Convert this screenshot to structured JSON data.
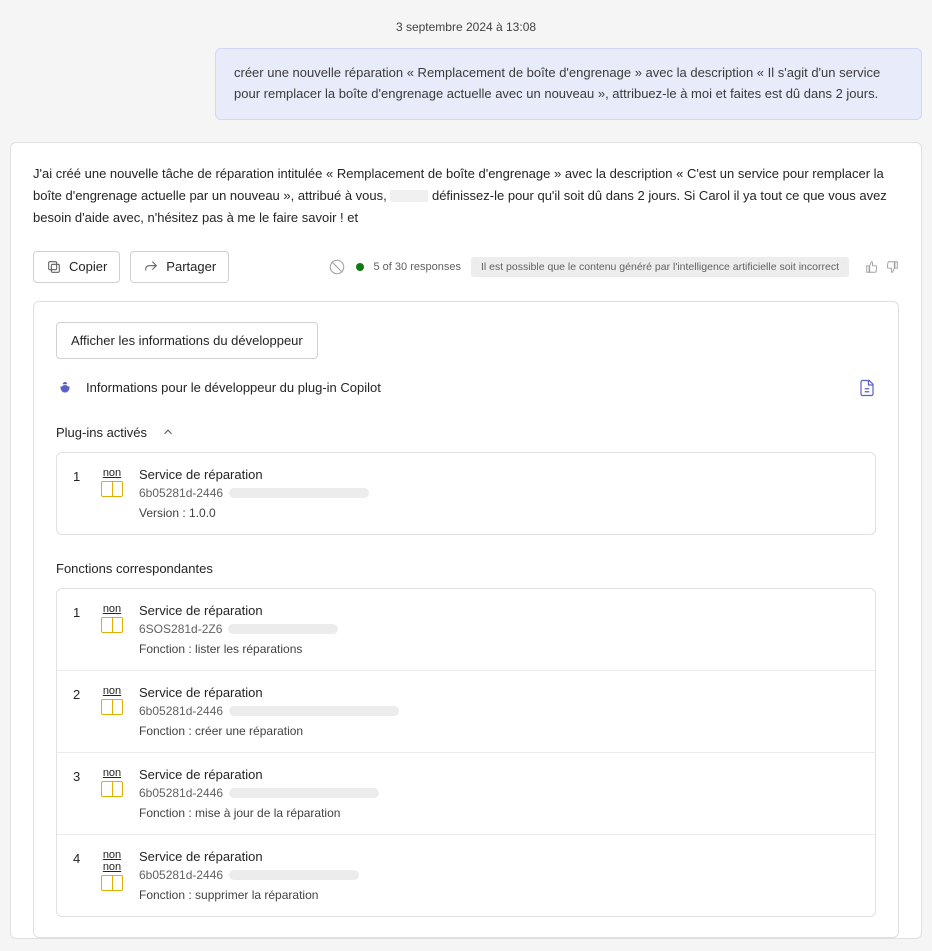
{
  "timestamp": "3 septembre 2024 à 13:08",
  "user_message": "créer une nouvelle réparation « Remplacement de boîte d'engrenage » avec la description « Il s'agit d'un service pour remplacer la boîte d'engrenage actuelle avec un nouveau », attribuez-le à moi et faites est dû dans 2 jours.",
  "response_text_before": "J'ai créé une nouvelle tâche de réparation intitulée « Remplacement de boîte d'engrenage » avec la description « C'est un service pour remplacer la boîte d'engrenage actuelle par un nouveau », attribué à vous, ",
  "response_text_after": " définissez-le pour qu'il soit dû dans 2 jours. Si Carol il ya tout ce que vous avez besoin d'aide avec, n'hésitez pas à me le faire savoir ! et",
  "actions": {
    "copy": "Copier",
    "share": "Partager"
  },
  "status": {
    "responses": "5 of 30 responses",
    "disclaimer": "Il est possible que le contenu généré par l'intelligence artificielle soit incorrect"
  },
  "dev": {
    "toggle": "Afficher les informations du développeur",
    "header": "Informations pour le développeur du plug-in Copilot",
    "plugins_label": "Plug-ins activés",
    "functions_label": "Fonctions correspondantes",
    "plugins": [
      {
        "idx": "1",
        "badge": "non",
        "title": "Service de réparation",
        "id": "6b05281d-2446",
        "sub": "Version : 1.0.0"
      }
    ],
    "functions": [
      {
        "idx": "1",
        "badge": "non",
        "title": "Service de réparation",
        "id": "6SOS281d-2Z6",
        "sub": "Fonction : lister les réparations"
      },
      {
        "idx": "2",
        "badge": "non",
        "title": "Service de réparation",
        "id": "6b05281d-2446",
        "sub": "Fonction : créer une réparation"
      },
      {
        "idx": "3",
        "badge": "non",
        "title": "Service de réparation",
        "id": "6b05281d-2446",
        "sub": "Fonction : mise à jour de la réparation"
      },
      {
        "idx": "4",
        "badge": "non non",
        "title": "Service de réparation",
        "id": "6b05281d-2446",
        "sub": "Fonction : supprimer la réparation"
      }
    ]
  }
}
